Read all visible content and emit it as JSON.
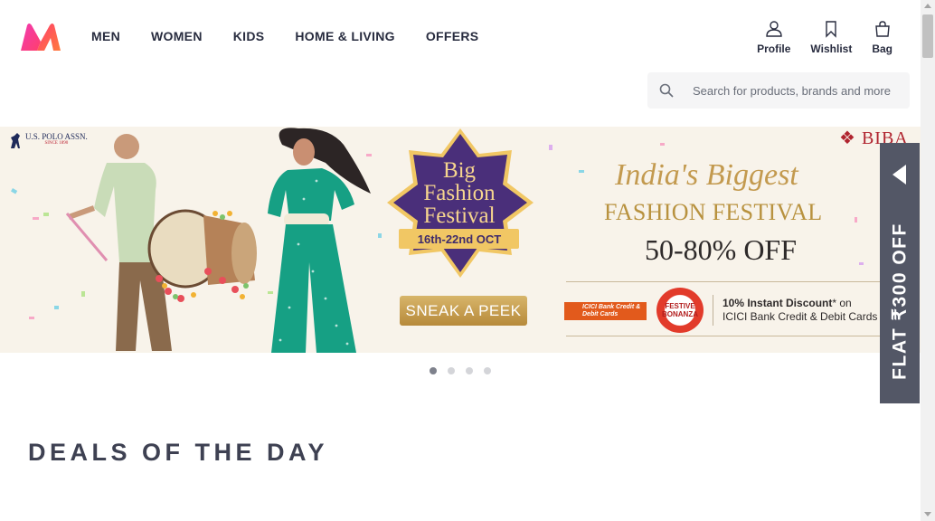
{
  "header": {
    "logo_name": "myntra-logo",
    "nav": [
      "MEN",
      "WOMEN",
      "KIDS",
      "HOME & LIVING",
      "OFFERS"
    ],
    "actions": [
      {
        "label": "Profile",
        "icon": "profile-icon"
      },
      {
        "label": "Wishlist",
        "icon": "bookmark-icon"
      },
      {
        "label": "Bag",
        "icon": "bag-icon"
      }
    ]
  },
  "search": {
    "placeholder": "Search for products, brands and more",
    "icon": "search-icon"
  },
  "banner": {
    "brand_left": "U.S. POLO ASSN.",
    "brand_left_sub": "SINCE 1890",
    "brand_right": "BIBA",
    "badge_line1": "Big",
    "badge_line2": "Fashion",
    "badge_line3": "Festival",
    "badge_dates": "16th-22nd OCT",
    "cta": "SNEAK A PEEK",
    "headline1": "India's Biggest",
    "headline2": "FASHION FESTIVAL",
    "offer": "50-80% OFF",
    "bank_logo": "ICICI Bank Credit & Debit Cards",
    "bonanza_badge": "FESTIVE BONANZA",
    "discount_bold": "10% Instant Discount",
    "discount_rest": "* on",
    "discount_line2": "ICICI Bank Credit & Debit Cards"
  },
  "side_tab": {
    "label": "FLAT ₹300 OFF",
    "icon": "caret-left-icon"
  },
  "carousel": {
    "dots": 4,
    "active_index": 0
  },
  "sections": {
    "deals_title": "DEALS OF THE DAY"
  },
  "colors": {
    "brand_pink": "#ff3f6c",
    "brand_orange": "#ff9f00",
    "text_dark": "#282c3f",
    "side_tab_bg": "#535766",
    "banner_bg": "#f8f3ea",
    "badge_purple": "#4a2f7a",
    "gold": "#c39a4f"
  }
}
